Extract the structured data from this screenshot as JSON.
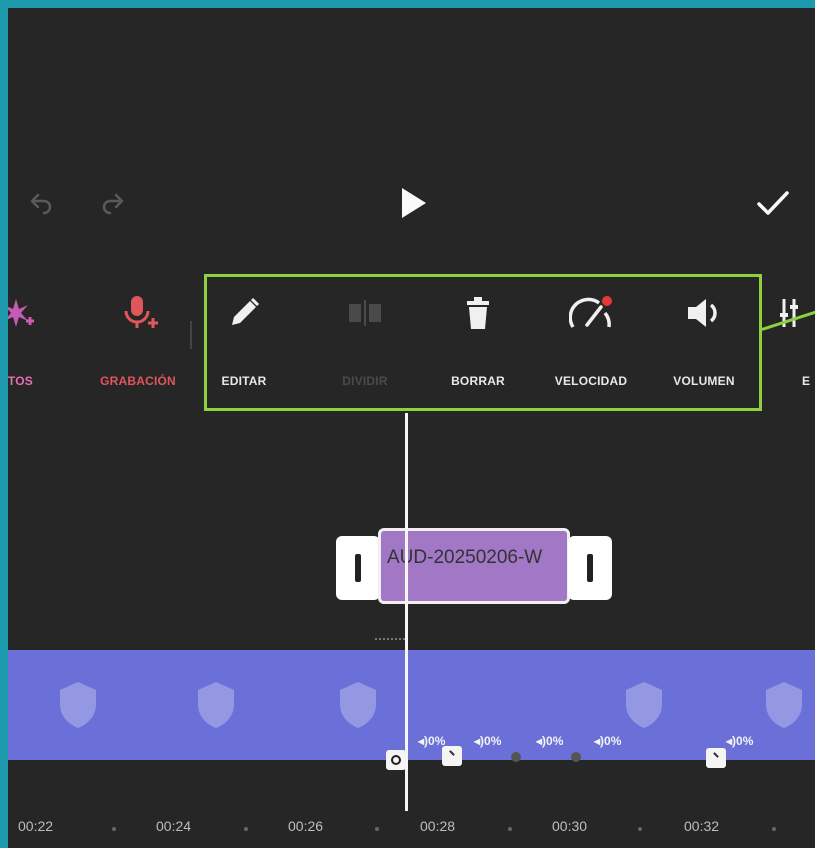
{
  "toolbar": {
    "labels": [
      "CTOS",
      "GRABACIÓN",
      "EDITAR",
      "DIVIDIR",
      "BORRAR",
      "VELOCIDAD",
      "VOLUMEN",
      "E"
    ]
  },
  "clip": {
    "name": "AUD-20250206-W"
  },
  "volume_labels": [
    "0%",
    "0%",
    "0%",
    "0%",
    "0%"
  ],
  "ruler": {
    "ticks": [
      "00:22",
      "00:24",
      "00:26",
      "00:28",
      "00:30",
      "00:32"
    ]
  },
  "colors": {
    "accent_highlight": "#8fd03f",
    "audio_clip": "#a177c6",
    "video_track": "#6b70d8",
    "record_red": "#e0565a",
    "effects_pink": "#e56fb0"
  }
}
